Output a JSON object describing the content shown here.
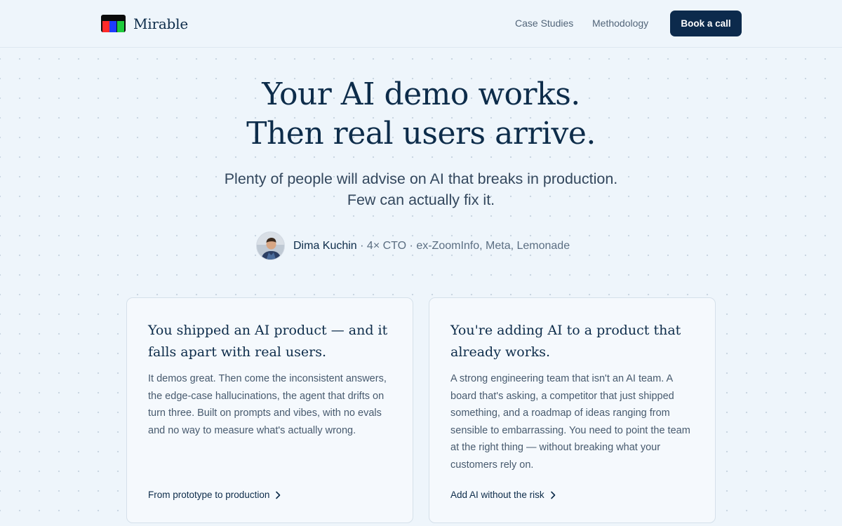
{
  "header": {
    "brand": "Mirable",
    "logo_colors": [
      "#ff2a2a",
      "#1f3cff",
      "#1fcc3c"
    ],
    "nav": [
      {
        "label": "Case Studies"
      },
      {
        "label": "Methodology"
      }
    ],
    "cta_label": "Book a call"
  },
  "hero": {
    "title_line1": "Your AI demo works.",
    "title_line2": "Then real users arrive.",
    "subtitle_line1": "Plenty of people will advise on AI that breaks in production.",
    "subtitle_line2": "Few can actually fix it."
  },
  "author": {
    "name": "Dima Kuchin",
    "credentials": " · 4× CTO · ex-ZoomInfo, Meta, Lemonade",
    "avatar_icon": "person-photo"
  },
  "cards": [
    {
      "title": "You shipped an AI product — and it falls apart with real users.",
      "body": "It demos great. Then come the inconsistent answers, the edge-case hallucinations, the agent that drifts on turn three. Built on prompts and vibes, with no evals and no way to measure what's actually wrong.",
      "link": "From prototype to production",
      "link_icon": "chevron-right-icon"
    },
    {
      "title": "You're adding AI to a product that already works.",
      "body": "A strong engineering team that isn't an AI team. A board that's asking, a competitor that just shipped something, and a roadmap of ideas ranging from sensible to embarrassing. You need to point the team at the right thing — without breaking what your customers rely on.",
      "link": "Add AI without the risk",
      "link_icon": "chevron-right-icon"
    }
  ],
  "colors": {
    "background": "#eef5fb",
    "primary": "#0c2a4c",
    "text_muted": "#526579",
    "card_bg": "#f5f9fd"
  }
}
